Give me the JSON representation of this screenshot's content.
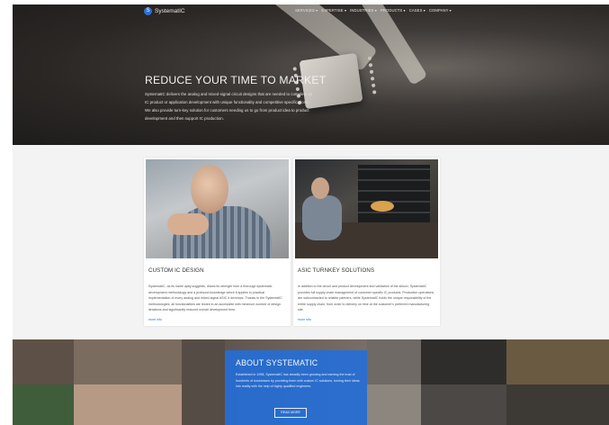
{
  "header": {
    "logo_text": "SystematIC",
    "menu": [
      "SERVICES ▾",
      "EXPERTISE ▾",
      "INDUSTRIES ▾",
      "PRODUCTS ▾",
      "CASES ▾",
      "COMPANY ▾"
    ]
  },
  "hero": {
    "title": "REDUCE YOUR TIME TO MARKET",
    "text": "SystematIC delivers the analog and mixed-signal circuit designs that are needed to complete an IC product or application development with unique functionality and competitive specifications. We also provide turn-key solution for customers needing us to go from product idea to product development and then support IC production."
  },
  "cards": [
    {
      "title": "CUSTOM IC DESIGN",
      "text": "SystematIC, as its name aptly suggests, draws its strength from a thorough systematic development methodology and a profound knowledge which it applies in practical implementation of every analog and mixed-signal ASIC it develops. Thanks to the SystematIC methodologies, all functionalities are tested in an accessible with minimum number of design iterations and significantly reduced overall development time.",
      "more": "more info"
    },
    {
      "title": "ASIC TURNKEY SOLUTIONS",
      "text": "In addition to the circuit and product development and validation of the silicon, SystematIC provides full supply chain management of customer specific IC products. Production operations are subcontracted to reliable partners, while SystematIC holds the unique responsibility of the entire supply chain, from order to delivery on time at the customer's preferred manufacturing site.",
      "more": "more info"
    }
  ],
  "about": {
    "title": "ABOUT SYSTEMATIC",
    "text": "Established in 1998, SystematIC has steadily been growing and earning the trust of hundreds of businesses by providing them with custom IC solutions, turning their ideas into reality with the help of highly qualified engineers.",
    "button": "READ MORE"
  }
}
